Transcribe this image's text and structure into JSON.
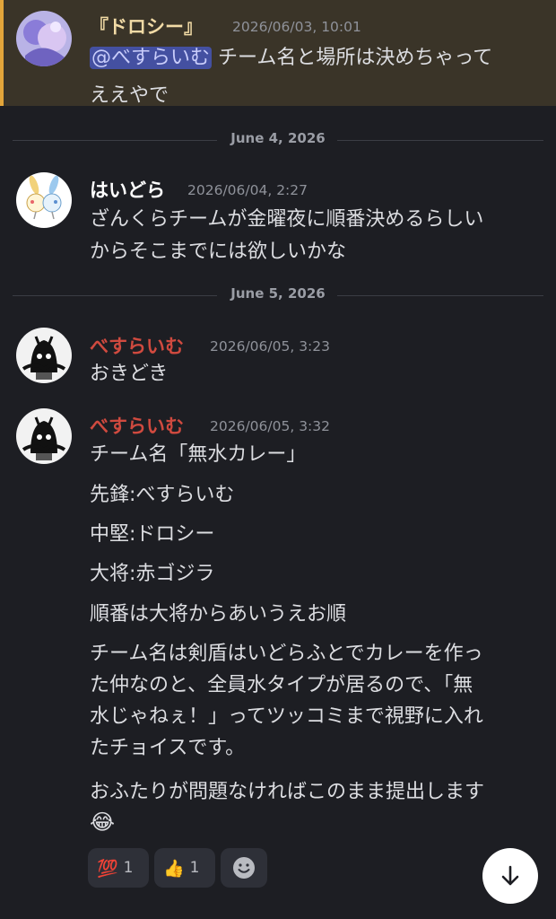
{
  "messages": {
    "m1": {
      "author": "『ドロシー』",
      "timestamp": "2026/06/03, 10:01",
      "mention": "@べすらいむ",
      "line1_rest": " チーム名と場所は決めちゃって",
      "line2": "ええやで"
    },
    "divider1": "June 4, 2026",
    "m2": {
      "author": "はいどら",
      "timestamp": "2026/06/04, 2:27",
      "lines": [
        "ざんくらチームが金曜夜に順番決めるらしい",
        "からそこまでには欲しいかな"
      ]
    },
    "divider2": "June 5, 2026",
    "m3": {
      "author": "べすらいむ",
      "timestamp": "2026/06/05, 3:23",
      "lines": [
        "おきどき"
      ]
    },
    "m4": {
      "author": "べすらいむ",
      "timestamp": "2026/06/05, 3:32",
      "lines": [
        "チーム名「無水カレー」",
        "先鋒:べすらいむ",
        "中堅:ドロシー",
        "大将:赤ゴジラ",
        "順番は大将からあいうえお順",
        "チーム名は剣盾はいどらふとでカレーを作っ",
        "た仲なのと、全員水タイプが居るので、「無",
        "水じゃねぇ！」ってツッコミまで視野に入れ",
        "たチョイスです。",
        "おふたりが問題なければこのまま提出します",
        "😂"
      ]
    }
  },
  "reactions": [
    {
      "emoji": "💯",
      "count": "1"
    },
    {
      "emoji": "👍",
      "count": "1"
    }
  ],
  "icons": {
    "add_reaction": "smiley-add-reaction-icon",
    "scroll_down": "arrow-down-icon"
  },
  "colors": {
    "background": "#1d1e23",
    "mention_highlight": "#3a3428",
    "mention_bar": "#e2a53a",
    "red_author": "#d04a3f"
  }
}
